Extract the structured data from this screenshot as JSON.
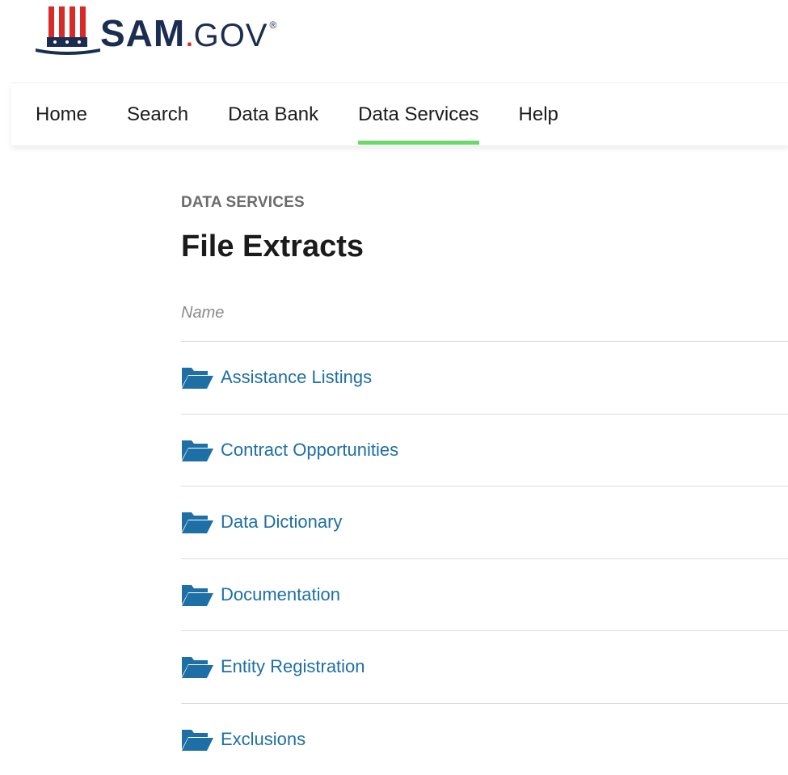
{
  "brand": {
    "name_main": "SAM",
    "name_dot": ".",
    "name_suffix": "GOV",
    "registered": "®",
    "colors": {
      "navy": "#1b2e52",
      "red": "#d92a2a"
    }
  },
  "nav": {
    "items": [
      {
        "label": "Home",
        "active": false
      },
      {
        "label": "Search",
        "active": false
      },
      {
        "label": "Data Bank",
        "active": false
      },
      {
        "label": "Data Services",
        "active": true
      },
      {
        "label": "Help",
        "active": false
      }
    ],
    "active_color": "#6ad86a"
  },
  "page": {
    "eyebrow": "DATA SERVICES",
    "title": "File Extracts",
    "column_header": "Name"
  },
  "folders": {
    "icon": "folder-open-icon",
    "color": "#1d6fa5",
    "items": [
      {
        "label": "Assistance Listings"
      },
      {
        "label": "Contract Opportunities"
      },
      {
        "label": "Data Dictionary"
      },
      {
        "label": "Documentation"
      },
      {
        "label": "Entity Registration"
      },
      {
        "label": "Exclusions"
      }
    ]
  }
}
